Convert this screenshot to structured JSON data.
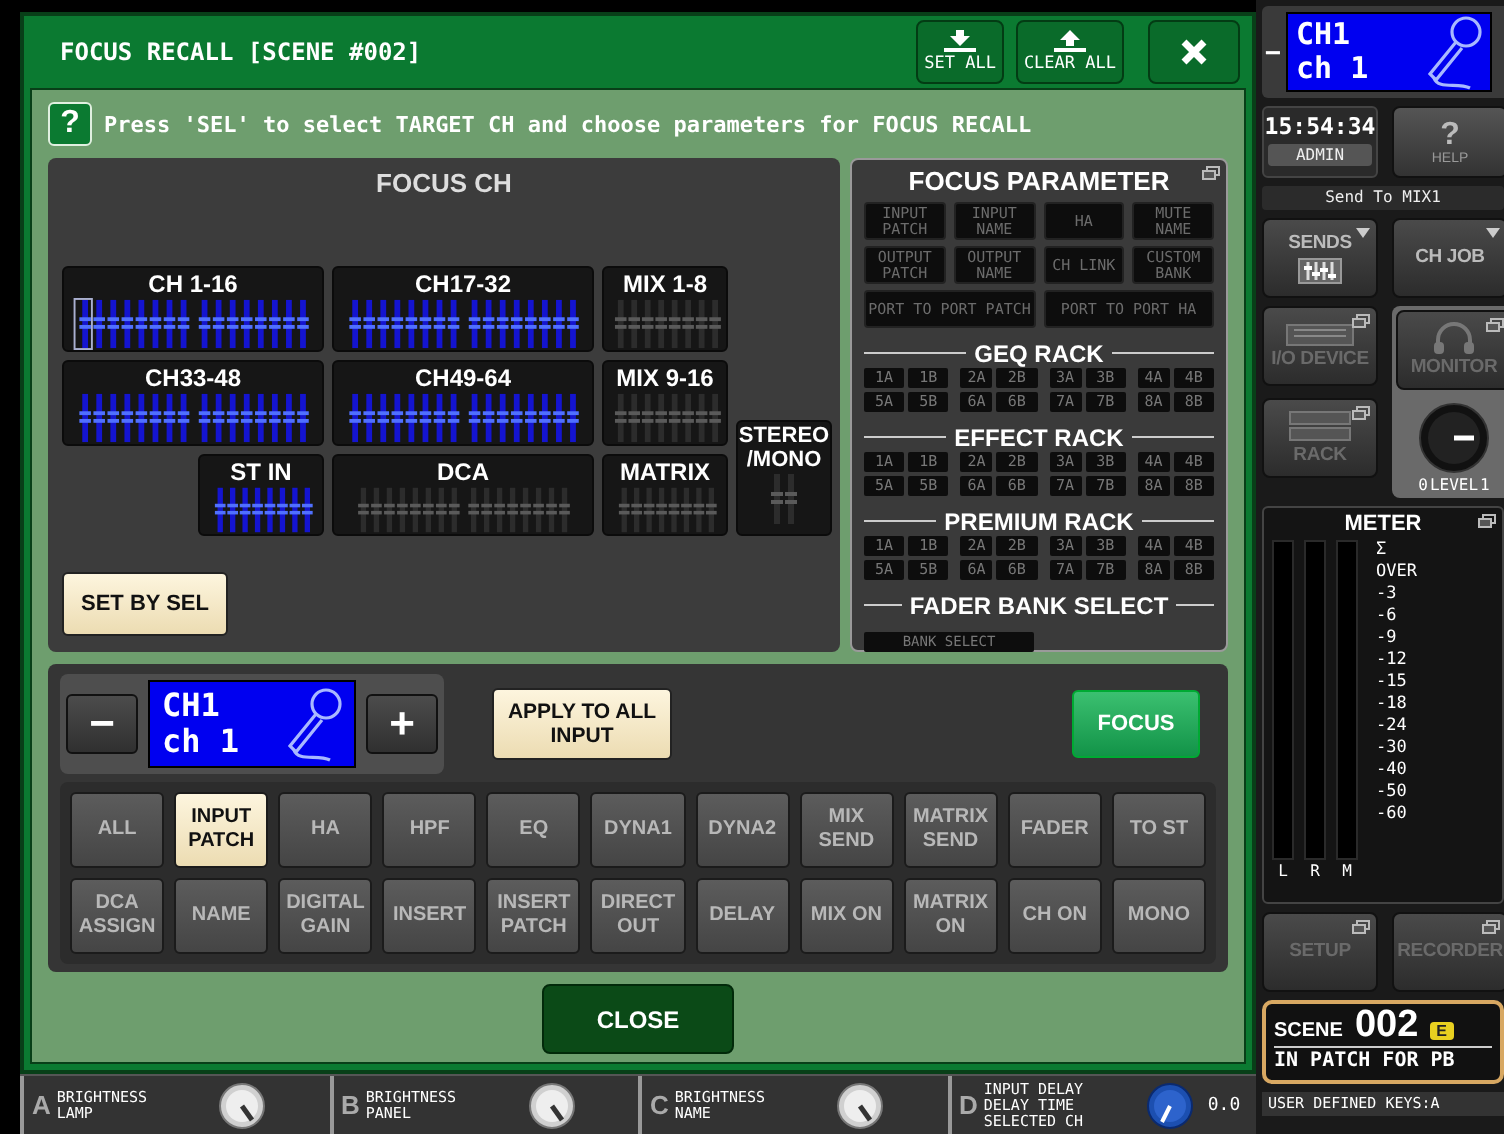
{
  "dialog": {
    "title": "FOCUS RECALL [SCENE #002]",
    "title_buttons": [
      {
        "kind": "set",
        "label": "SET ALL"
      },
      {
        "kind": "clear",
        "label": "CLEAR ALL"
      },
      {
        "kind": "close"
      }
    ],
    "help": {
      "icon": "?",
      "text": "Press 'SEL' to select TARGET CH and choose parameters for FOCUS RECALL"
    },
    "focus_ch": {
      "title": "FOCUS CH",
      "groups": [
        {
          "label": "CH 1-16",
          "kind": "bank16",
          "selected": true,
          "cursor": true
        },
        {
          "label": "CH17-32",
          "kind": "bank16",
          "selected": true,
          "cursor": false
        },
        {
          "label": "MIX 1-8",
          "kind": "bank8",
          "selected": false,
          "cursor": false
        },
        {
          "label": "CH33-48",
          "kind": "bank16",
          "selected": true,
          "cursor": false
        },
        {
          "label": "CH49-64",
          "kind": "bank16",
          "selected": true,
          "cursor": false
        },
        {
          "label": "MIX 9-16",
          "kind": "bank8",
          "selected": false,
          "cursor": false
        },
        {
          "label": "ST IN",
          "kind": "bank8",
          "selected": true,
          "cursor": false
        },
        {
          "label": "DCA",
          "kind": "bank16",
          "selected": false,
          "cursor": false
        },
        {
          "label": "MATRIX",
          "kind": "bank8",
          "selected": false,
          "cursor": false
        },
        {
          "label": "STEREO /MONO",
          "kind": "bank2",
          "selected": false,
          "cursor": false
        }
      ],
      "set_by_sel": "SET BY SEL"
    },
    "focus_parameter": {
      "title": "FOCUS PARAMETER",
      "popup": true,
      "params": [
        {
          "label": "INPUT PATCH",
          "kind": "normal",
          "on": false
        },
        {
          "label": "INPUT NAME",
          "kind": "normal",
          "on": false
        },
        {
          "label": "HA",
          "kind": "normal",
          "on": false
        },
        {
          "label": "MUTE NAME",
          "kind": "normal",
          "on": false
        },
        {
          "label": "OUTPUT PATCH",
          "kind": "normal",
          "on": false
        },
        {
          "label": "OUTPUT NAME",
          "kind": "normal",
          "on": false
        },
        {
          "label": "CH LINK",
          "kind": "normal",
          "on": false
        },
        {
          "label": "CUSTOM BANK",
          "kind": "normal",
          "on": false
        },
        {
          "label": "PORT TO PORT PATCH",
          "kind": "wide",
          "on": false
        },
        {
          "label": "PORT TO PORT HA",
          "kind": "wide",
          "on": false
        }
      ],
      "racks": [
        {
          "title": "GEQ RACK",
          "slots": [
            {
              "label": "1A",
              "on": false
            },
            {
              "label": "1B",
              "on": false
            },
            {
              "label": "2A",
              "on": false
            },
            {
              "label": "2B",
              "on": false
            },
            {
              "label": "3A",
              "on": false
            },
            {
              "label": "3B",
              "on": false
            },
            {
              "label": "4A",
              "on": false
            },
            {
              "label": "4B",
              "on": false
            },
            {
              "label": "5A",
              "on": false
            },
            {
              "label": "5B",
              "on": false
            },
            {
              "label": "6A",
              "on": false
            },
            {
              "label": "6B",
              "on": false
            },
            {
              "label": "7A",
              "on": false
            },
            {
              "label": "7B",
              "on": false
            },
            {
              "label": "8A",
              "on": false
            },
            {
              "label": "8B",
              "on": false
            }
          ]
        },
        {
          "title": "EFFECT RACK",
          "slots": [
            {
              "label": "1A",
              "on": false
            },
            {
              "label": "1B",
              "on": false
            },
            {
              "label": "2A",
              "on": false
            },
            {
              "label": "2B",
              "on": false
            },
            {
              "label": "3A",
              "on": false
            },
            {
              "label": "3B",
              "on": false
            },
            {
              "label": "4A",
              "on": false
            },
            {
              "label": "4B",
              "on": false
            },
            {
              "label": "5A",
              "on": false
            },
            {
              "label": "5B",
              "on": false
            },
            {
              "label": "6A",
              "on": false
            },
            {
              "label": "6B",
              "on": false
            },
            {
              "label": "7A",
              "on": false
            },
            {
              "label": "7B",
              "on": false
            },
            {
              "label": "8A",
              "on": false
            },
            {
              "label": "8B",
              "on": false
            }
          ]
        },
        {
          "title": "PREMIUM RACK",
          "slots": [
            {
              "label": "1A",
              "on": false
            },
            {
              "label": "1B",
              "on": false
            },
            {
              "label": "2A",
              "on": false
            },
            {
              "label": "2B",
              "on": false
            },
            {
              "label": "3A",
              "on": false
            },
            {
              "label": "3B",
              "on": false
            },
            {
              "label": "4A",
              "on": false
            },
            {
              "label": "4B",
              "on": false
            },
            {
              "label": "5A",
              "on": false
            },
            {
              "label": "5B",
              "on": false
            },
            {
              "label": "6A",
              "on": false
            },
            {
              "label": "6B",
              "on": false
            },
            {
              "label": "7A",
              "on": false
            },
            {
              "label": "7B",
              "on": false
            },
            {
              "label": "8A",
              "on": false
            },
            {
              "label": "8B",
              "on": false
            }
          ]
        }
      ],
      "fader_bank": {
        "title": "FADER BANK SELECT",
        "button": {
          "label": "BANK SELECT",
          "on": false
        }
      }
    },
    "channel": {
      "minus": "−",
      "name": "CH1",
      "label": "ch 1",
      "plus": "+"
    },
    "apply_button": "APPLY TO ALL INPUT",
    "focus_button": "FOCUS",
    "recall_params": [
      {
        "label": "ALL",
        "on": false
      },
      {
        "label": "INPUT PATCH",
        "on": true
      },
      {
        "label": "HA",
        "on": false
      },
      {
        "label": "HPF",
        "on": false
      },
      {
        "label": "EQ",
        "on": false
      },
      {
        "label": "DYNA1",
        "on": false
      },
      {
        "label": "DYNA2",
        "on": false
      },
      {
        "label": "MIX SEND",
        "on": false
      },
      {
        "label": "MATRIX SEND",
        "on": false
      },
      {
        "label": "FADER",
        "on": false
      },
      {
        "label": "TO ST",
        "on": false
      },
      {
        "label": "DCA ASSIGN",
        "on": false
      },
      {
        "label": "NAME",
        "on": false
      },
      {
        "label": "DIGITAL GAIN",
        "on": false
      },
      {
        "label": "INSERT",
        "on": false
      },
      {
        "label": "INSERT PATCH",
        "on": false
      },
      {
        "label": "DIRECT OUT",
        "on": false
      },
      {
        "label": "DELAY",
        "on": false
      },
      {
        "label": "MIX ON",
        "on": false
      },
      {
        "label": "MATRIX ON",
        "on": false
      },
      {
        "label": "CH ON",
        "on": false
      },
      {
        "label": "MONO",
        "on": false
      }
    ],
    "close_button": "CLOSE"
  },
  "side_panel": {
    "channel": {
      "minus": "−",
      "name": "CH1",
      "label": "ch 1"
    },
    "time": "15:54:34",
    "user": "ADMIN",
    "help": {
      "icon": "?",
      "label": "HELP"
    },
    "send_target": "Send To MIX1",
    "top_buttons": [
      {
        "label": "SENDS",
        "kind": "sends",
        "disabled": false
      },
      {
        "label": "CH JOB",
        "kind": "menu",
        "disabled": false
      }
    ],
    "left_buttons": [
      {
        "label": "I/O DEVICE",
        "kind": "device",
        "disabled": true
      },
      {
        "label": "RACK",
        "kind": "rack",
        "disabled": true
      }
    ],
    "monitor_button": {
      "label": "MONITOR",
      "disabled": true
    },
    "monitor_level": {
      "min": "0",
      "label": "LEVEL",
      "max": "1"
    },
    "meter": {
      "title": "METER",
      "sigma": "Σ",
      "scale": [
        "OVER",
        "-3",
        "-6",
        "-9",
        "-12",
        "-15",
        "-18",
        "-24",
        "-30",
        "-40",
        "-50",
        "-60"
      ],
      "channels": [
        "L",
        "R",
        "M"
      ]
    },
    "lower_buttons": [
      {
        "label": "SETUP",
        "disabled": true
      },
      {
        "label": "RECORDER",
        "disabled": true
      }
    ],
    "scene": {
      "label": "SCENE",
      "number": "002",
      "badge": "E",
      "title": "IN PATCH FOR PB"
    },
    "user_keys_label": "USER DEFINED KEYS:A"
  },
  "user_keys": [
    {
      "letter": "A",
      "text": "BRIGHTNESS\nLAMP",
      "kind": "silver"
    },
    {
      "letter": "B",
      "text": "BRIGHTNESS\nPANEL",
      "kind": "silver"
    },
    {
      "letter": "C",
      "text": "BRIGHTNESS\nNAME",
      "kind": "silver"
    },
    {
      "letter": "D",
      "text": "INPUT DELAY\nDELAY TIME\nSELECTED CH",
      "kind": "blue",
      "value": "0.0"
    }
  ]
}
